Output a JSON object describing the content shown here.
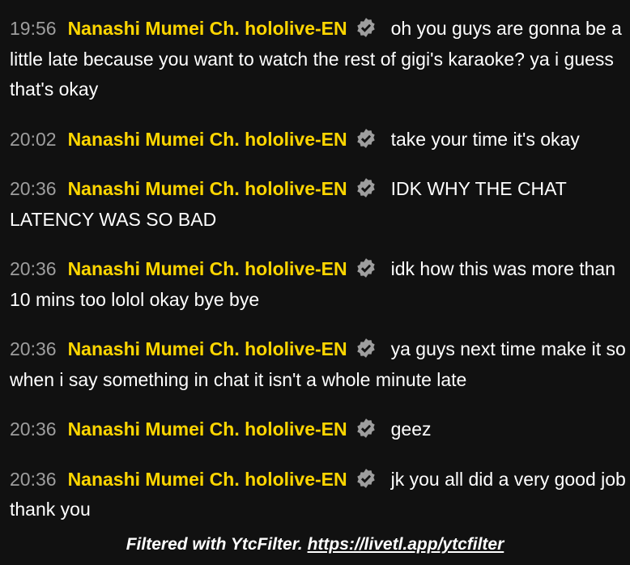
{
  "colors": {
    "background": "#111111",
    "timestamp": "#9e9e9e",
    "author": "#ffd600",
    "text": "#ffffff",
    "badge": "#9e9e9e"
  },
  "messages": [
    {
      "time": "19:56",
      "author": "Nanashi Mumei Ch. hololive-EN",
      "badge_icon": "verified-badge-icon",
      "text": "oh you guys are gonna be a little late because you want to watch the rest of gigi's karaoke? ya i guess that's okay"
    },
    {
      "time": "20:02",
      "author": "Nanashi Mumei Ch. hololive-EN",
      "badge_icon": "verified-badge-icon",
      "text": "take your time it's okay"
    },
    {
      "time": "20:36",
      "author": "Nanashi Mumei Ch. hololive-EN",
      "badge_icon": "verified-badge-icon",
      "text": "IDK WHY THE CHAT LATENCY WAS SO BAD"
    },
    {
      "time": "20:36",
      "author": "Nanashi Mumei Ch. hololive-EN",
      "badge_icon": "verified-badge-icon",
      "text": "idk how this was more than 10 mins too lolol okay bye bye"
    },
    {
      "time": "20:36",
      "author": "Nanashi Mumei Ch. hololive-EN",
      "badge_icon": "verified-badge-icon",
      "text": "ya guys next time make it so when i say something in chat it isn't a whole minute late"
    },
    {
      "time": "20:36",
      "author": "Nanashi Mumei Ch. hololive-EN",
      "badge_icon": "verified-badge-icon",
      "text": "geez"
    },
    {
      "time": "20:36",
      "author": "Nanashi Mumei Ch. hololive-EN",
      "badge_icon": "verified-badge-icon",
      "text": "jk you all did a very good job thank you"
    }
  ],
  "footer": {
    "label": "Filtered with YtcFilter.",
    "link": "https://livetl.app/ytcfilter"
  }
}
